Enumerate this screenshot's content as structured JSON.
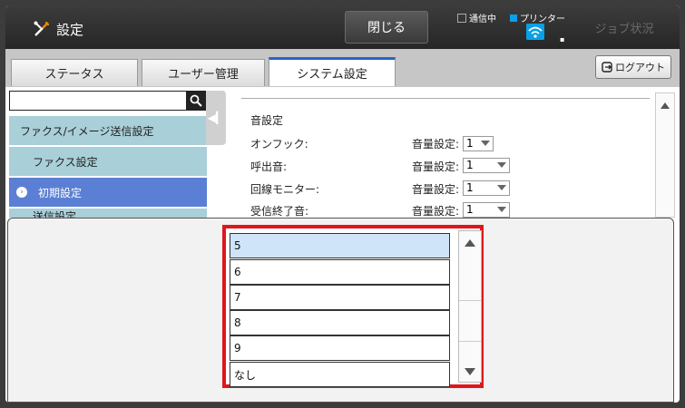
{
  "header": {
    "title": "設定",
    "close_label": "閉じる",
    "status_comm": "通信中",
    "status_printer": "プリンター",
    "job_status_label": "ジョブ状況"
  },
  "tabs": [
    {
      "label": "ステータス"
    },
    {
      "label": "ユーザー管理"
    },
    {
      "label": "システム設定"
    }
  ],
  "logout_label": "ログアウト",
  "search": {
    "value": ""
  },
  "sidebar": {
    "items": [
      {
        "label": "ファクス/イメージ送信設定"
      },
      {
        "label": "ファクス設定"
      },
      {
        "label": "初期設定"
      },
      {
        "label": "送信設定"
      }
    ]
  },
  "section": {
    "heading": "音設定",
    "volume_label": "音量設定:",
    "rows": [
      {
        "label": "オンフック:",
        "value": "1"
      },
      {
        "label": "呼出音:",
        "value": "1"
      },
      {
        "label": "回線モニター:",
        "value": "1"
      },
      {
        "label": "受信終了音:",
        "value": "1"
      }
    ]
  },
  "dropdown": {
    "options": [
      "5",
      "6",
      "7",
      "8",
      "9",
      "なし"
    ],
    "selected": "5"
  },
  "colors": {
    "accent_blue": "#2b63c6",
    "sidebar_selected": "#5b7fd4",
    "sidebar_item": "#a9cfd9",
    "highlight_red": "#e0161d",
    "status_blue": "#0aa0e8"
  }
}
